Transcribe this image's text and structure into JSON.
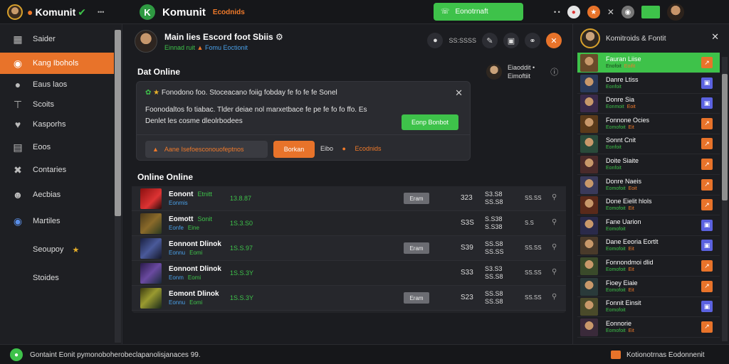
{
  "topbar": {
    "brand": "Komunit",
    "small_text": "•••",
    "center_brand": "Komunit",
    "center_sub": "Ecodnids",
    "cta_label": "Eonotrnaft",
    "right_text": "• •"
  },
  "sidebar": {
    "items": [
      {
        "label": "Saider",
        "icon": "grid-icon"
      },
      {
        "label": "Kang Ibohols",
        "icon": "globe-icon"
      },
      {
        "label": "Eaus laos",
        "icon": "circle-icon"
      },
      {
        "label": "Scoits",
        "icon": "tool-icon"
      },
      {
        "label": "Kasporhs",
        "icon": "heart-icon"
      },
      {
        "label": "Eoos",
        "icon": "card-icon"
      },
      {
        "label": "Contaries",
        "icon": "wrench-icon"
      },
      {
        "label": "Aecbias",
        "icon": "person-icon"
      },
      {
        "label": "Martiles",
        "icon": "globe-icon"
      },
      {
        "label": "Seoupoy",
        "icon": "star-icon"
      },
      {
        "label": "Stoides",
        "icon": "none"
      }
    ]
  },
  "main": {
    "channel_title": "Main lies Escord foot Sbiis",
    "channel_sub_green": "Einnad ruit",
    "channel_sub_orange": "Fomu",
    "channel_sub_blue": "Eoctionit",
    "head_right_text": "SS:SSSS",
    "section_online": "Dat Online",
    "who_label": "Eiaoddit •",
    "who_sub": "Eimoftiit",
    "card": {
      "line1": "Fonodono foo. Stoceacano foiig fobday fe fo fe fe Sonel",
      "line2": "Foonodaltos fo tiabac. Tlder deiae nol marxetbace fe pe fe fo fo ffo. Es",
      "line3": "Denlet les cosme dleolrbodees",
      "button": "Eonp Bonbot",
      "pill_dark": "Aane Isefoesconouofeptnos",
      "pill_orange": "Borkan",
      "extra": "Eibo",
      "extra_orange": "Ecodnids"
    },
    "section_online2": "Online Online",
    "rows": [
      {
        "name": "Eonont",
        "name_g": "Etnitt",
        "sub": "Eonmis",
        "val": "13.8.87",
        "tag": "Eram",
        "n1": "323",
        "n2a": "S3.S8",
        "n2b": "SS.S8",
        "n3": "SS.SS"
      },
      {
        "name": "Eomott",
        "name_g": "Sonit",
        "sub": "Eonfe",
        "sub_g": "Eine",
        "val": "1S.3.S0",
        "tag": "",
        "n1": "S3S",
        "n2a": "S.S38",
        "n2b": "S.S38",
        "n3": "S.S"
      },
      {
        "name": "Eonnont Dlinok",
        "name_g": "",
        "sub": "Eonnu",
        "sub_g": "Eomi",
        "val": "1S.S.97",
        "tag": "Eram",
        "n1": "S39",
        "n2a": "SS.S8",
        "n2b": "SS.SS",
        "n3": "SS.SS"
      },
      {
        "name": "Eonnont Dlinok",
        "name_g": "",
        "sub": "Eonm",
        "sub_g": "Eomi",
        "val": "1S.S.3Y",
        "tag": "",
        "n1": "S33",
        "n2a": "S3.S3",
        "n2b": "SS.S8",
        "n3": "SS.SS"
      },
      {
        "name": "Eomont Dlinok",
        "name_g": "",
        "sub": "Eonnu",
        "sub_g": "Eomi",
        "val": "1S.S.3Y",
        "tag": "Eram",
        "n1": "S23",
        "n2a": "SS.S8",
        "n2b": "SS.S8",
        "n3": "SS.SS"
      }
    ]
  },
  "rpanel": {
    "title": "Komitroids & Fontit",
    "members": [
      {
        "name": "Fauran Liise",
        "sub": "Enofoit",
        "sub_o": "Eoifit",
        "btn": "or",
        "active": true
      },
      {
        "name": "Danre Ltiss",
        "sub": "Eonfoit",
        "sub_o": "",
        "btn": "bl"
      },
      {
        "name": "Donre Sia",
        "sub": "Eonmoit",
        "sub_o": "Eoit",
        "btn": "bl"
      },
      {
        "name": "Fonnone Ocies",
        "sub": "Eomofoit",
        "sub_o": "Eit",
        "btn": "or"
      },
      {
        "name": "Sonnt Cnit",
        "sub": "Eonfoit",
        "sub_o": "",
        "btn": "or"
      },
      {
        "name": "Doite Siaite",
        "sub": "Eonfoit",
        "sub_o": "",
        "btn": "or"
      },
      {
        "name": "Donre Naeis",
        "sub": "Eomofoit",
        "sub_o": "Eoit",
        "btn": "or"
      },
      {
        "name": "Done Eielit hlols",
        "sub": "Eomofoit",
        "sub_o": "Eit",
        "btn": "or"
      },
      {
        "name": "Fane Uarion",
        "sub": "Eomofoit",
        "sub_o": "",
        "btn": "bl"
      },
      {
        "name": "Dane Eeoria Eortlt",
        "sub": "Eomofoit",
        "sub_o": "Eit",
        "btn": "bl"
      },
      {
        "name": "Fonnondmoi dlid",
        "sub": "Eomofoit",
        "sub_o": "Eit",
        "btn": "or"
      },
      {
        "name": "Fioey Eiaie",
        "sub": "Eomofoit",
        "sub_o": "Eit",
        "btn": "or"
      },
      {
        "name": "Fonnit Einsit",
        "sub": "Eomofoit",
        "sub_o": "",
        "btn": "bl"
      },
      {
        "name": "Eonnorie",
        "sub": "Eomofoit",
        "sub_o": "Eit",
        "btn": "or"
      }
    ]
  },
  "status": {
    "left": "Gontaint Eonit pymonoboherobeclapanolisjanaces 99.",
    "right": "Kotionotrnas Eodonnenit"
  }
}
